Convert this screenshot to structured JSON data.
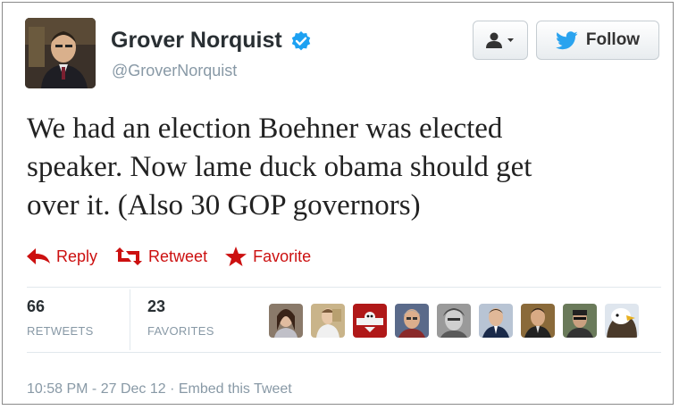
{
  "tweet": {
    "author": {
      "display_name": "Grover Norquist",
      "handle": "@GroverNorquist",
      "verified": true,
      "avatar_icon": "profile-photo"
    },
    "header_buttons": {
      "user_actions_icon": "user-dropdown-icon",
      "follow_label": "Follow",
      "follow_icon": "twitter-bird-icon"
    },
    "text_lines": [
      "We had an election Boehner was elected",
      "speaker. Now lame duck obama should get",
      "over it. (Also 30 GOP governors)"
    ],
    "actions": {
      "reply": "Reply",
      "retweet": "Retweet",
      "favorite": "Favorite"
    },
    "stats": {
      "retweets_count": "66",
      "retweets_label": "RETWEETS",
      "favorites_count": "23",
      "favorites_label": "FAVORITES"
    },
    "faces": [
      "face-1",
      "face-2",
      "face-3",
      "face-4",
      "face-5",
      "face-6",
      "face-7",
      "face-8",
      "face-9"
    ],
    "footer": {
      "timestamp": "10:58 PM - 27 Dec 12",
      "separator": " · ",
      "embed_label": "Embed this Tweet"
    }
  },
  "colors": {
    "accent_red": "#cc1010",
    "verified_blue": "#1da1f2",
    "twitter_blue": "#2aa3ef",
    "muted": "#8899a6"
  }
}
